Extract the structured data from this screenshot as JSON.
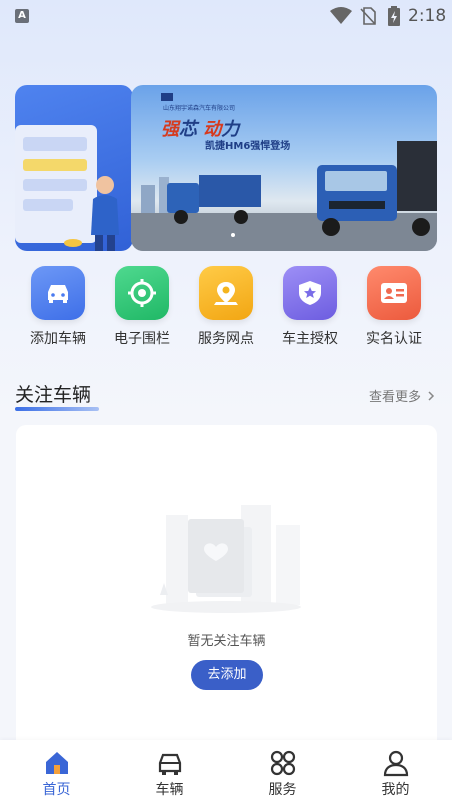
{
  "status_bar": {
    "time": "2:18",
    "app_badge": "A"
  },
  "banner": {
    "company_name": "山东翔宇诺森汽车有限公司",
    "headline_part1": "强",
    "headline_part2": "芯",
    "headline_part3": "动",
    "headline_part4": "力",
    "headline_model": "凯捷HM6强悍登场"
  },
  "quick_actions": [
    {
      "label": "添加车辆",
      "icon": "car-icon",
      "color": "#4a7bf0"
    },
    {
      "label": "电子围栏",
      "icon": "target-icon",
      "color": "#27c277"
    },
    {
      "label": "服务网点",
      "icon": "map-pin-icon",
      "color": "#f4b41d"
    },
    {
      "label": "车主授权",
      "icon": "shield-star-icon",
      "color": "#7a6de8"
    },
    {
      "label": "实名认证",
      "icon": "id-card-icon",
      "color": "#f06a50"
    }
  ],
  "followed": {
    "title": "关注车辆",
    "more": "查看更多",
    "empty_text": "暂无关注车辆",
    "add_button": "去添加"
  },
  "tabs": [
    {
      "label": "首页",
      "icon": "home-icon",
      "active": true
    },
    {
      "label": "车辆",
      "icon": "car-outline-icon",
      "active": false
    },
    {
      "label": "服务",
      "icon": "grid-icon",
      "active": false
    },
    {
      "label": "我的",
      "icon": "person-icon",
      "active": false
    }
  ]
}
